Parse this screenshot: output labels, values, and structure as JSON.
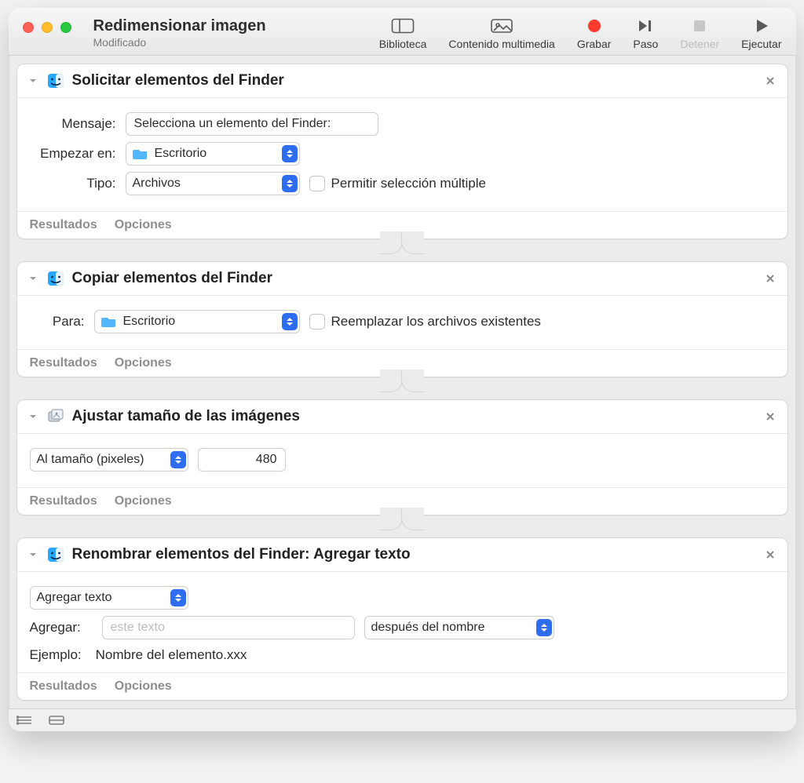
{
  "window": {
    "title": "Redimensionar imagen",
    "subtitle": "Modificado"
  },
  "toolbar": {
    "library": "Biblioteca",
    "media": "Contenido multimedia",
    "record": "Grabar",
    "step": "Paso",
    "stop": "Detener",
    "run": "Ejecutar"
  },
  "common": {
    "results": "Resultados",
    "options": "Opciones"
  },
  "actions": [
    {
      "title": "Solicitar elementos del Finder",
      "message_label": "Mensaje:",
      "message_value": "Selecciona un elemento del Finder:",
      "start_label": "Empezar en:",
      "start_value": "Escritorio",
      "type_label": "Tipo:",
      "type_value": "Archivos",
      "multi_label": "Permitir selección múltiple"
    },
    {
      "title": "Copiar elementos del Finder",
      "to_label": "Para:",
      "to_value": "Escritorio",
      "replace_label": "Reemplazar los archivos existentes"
    },
    {
      "title": "Ajustar tamaño de las imágenes",
      "mode_value": "Al tamaño (pixeles)",
      "size_value": "480"
    },
    {
      "title": "Renombrar elementos del Finder: Agregar texto",
      "mode_value": "Agregar texto",
      "add_label": "Agregar:",
      "add_placeholder": "este texto",
      "position_value": "después del nombre",
      "example_label": "Ejemplo:",
      "example_value": "Nombre del elemento.xxx"
    }
  ]
}
